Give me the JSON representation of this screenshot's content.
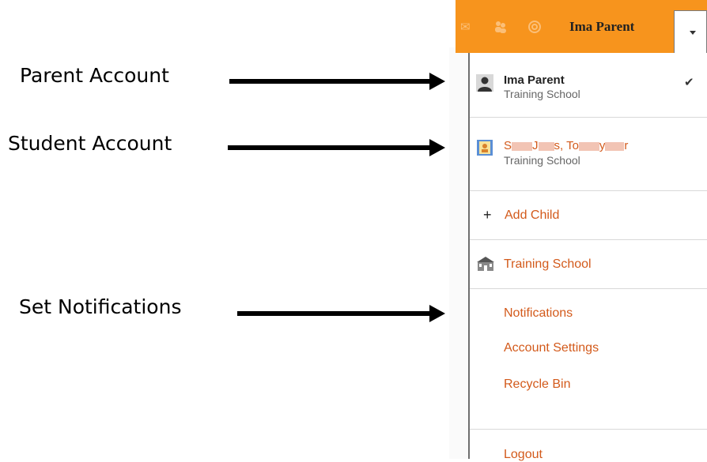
{
  "annotations": {
    "parent": "Parent Account",
    "student": "Student Account",
    "notifications": "Set Notifications"
  },
  "header": {
    "user_name": "Ima Parent"
  },
  "accounts": [
    {
      "name": "Ima Parent",
      "school": "Training School",
      "checked_mark": "✔"
    },
    {
      "name_parts": [
        "S",
        "J",
        "s, To",
        "y",
        "r"
      ],
      "school": "Training School"
    }
  ],
  "menu": {
    "add_child": "Add Child",
    "add_child_icon": "+",
    "school": "Training School",
    "notifications": "Notifications",
    "account_settings": "Account Settings",
    "recycle_bin": "Recycle Bin",
    "logout": "Logout"
  },
  "colors": {
    "header_bg": "#f7941d",
    "link": "#d35a1b"
  },
  "icons": {
    "mail": "mail-icon",
    "people": "people-icon",
    "help": "help-icon",
    "parent": "person-icon",
    "student": "student-id-icon",
    "school": "school-building-icon",
    "caret": "chevron-down-icon"
  }
}
